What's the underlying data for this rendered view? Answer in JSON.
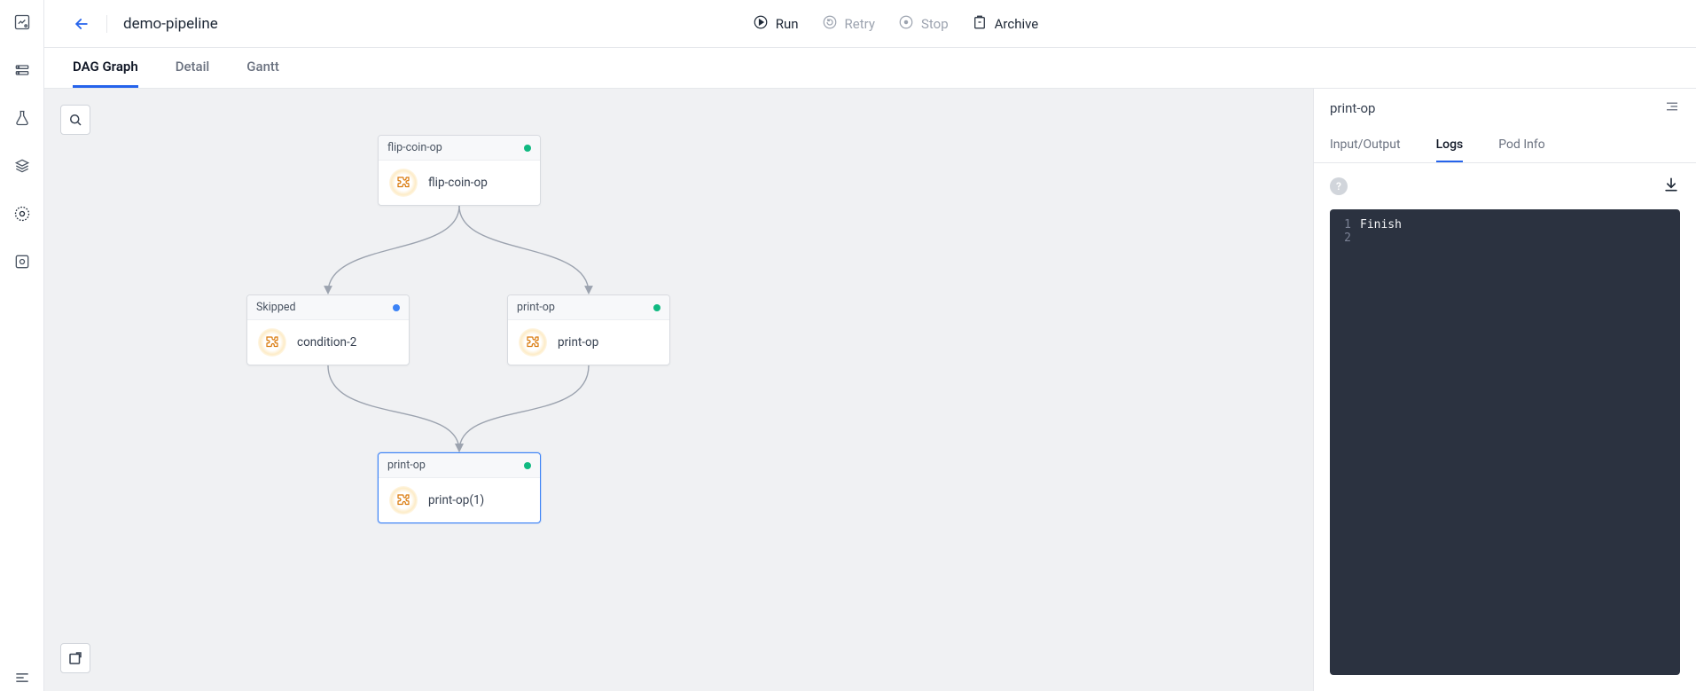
{
  "header": {
    "title": "demo-pipeline",
    "actions": {
      "run": "Run",
      "retry": "Retry",
      "stop": "Stop",
      "archive": "Archive"
    }
  },
  "view_tabs": {
    "dag": "DAG Graph",
    "detail": "Detail",
    "gantt": "Gantt"
  },
  "nodes": {
    "flip": {
      "head": "flip-coin-op",
      "body": "flip-coin-op",
      "status": "green"
    },
    "skipped": {
      "head": "Skipped",
      "body": "condition-2",
      "status": "blue"
    },
    "print0": {
      "head": "print-op",
      "body": "print-op",
      "status": "green"
    },
    "print1": {
      "head": "print-op",
      "body": "print-op(1)",
      "status": "green"
    }
  },
  "panel": {
    "title": "print-op",
    "tabs": {
      "io": "Input/Output",
      "logs": "Logs",
      "pod": "Pod Info"
    },
    "log_lines": {
      "l1_num": "1",
      "l1_txt": "Finish",
      "l2_num": "2",
      "l2_txt": ""
    }
  }
}
